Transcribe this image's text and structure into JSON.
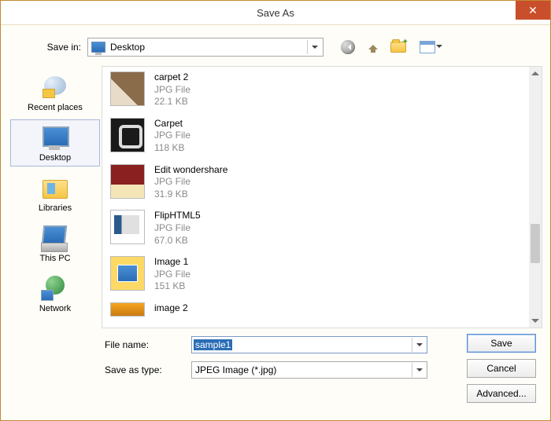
{
  "window": {
    "title": "Save As"
  },
  "top": {
    "save_in_label": "Save in:",
    "location": "Desktop"
  },
  "sidebar": {
    "places": [
      {
        "label": "Recent places"
      },
      {
        "label": "Desktop"
      },
      {
        "label": "Libraries"
      },
      {
        "label": "This PC"
      },
      {
        "label": "Network"
      }
    ],
    "selected_index": 1
  },
  "files": [
    {
      "name": "carpet 2",
      "type": "JPG File",
      "size": "22.1 KB"
    },
    {
      "name": "Carpet",
      "type": "JPG File",
      "size": "118 KB"
    },
    {
      "name": "Edit wondershare",
      "type": "JPG File",
      "size": "31.9 KB"
    },
    {
      "name": "FlipHTML5",
      "type": "JPG File",
      "size": "67.0 KB"
    },
    {
      "name": "Image 1",
      "type": "JPG File",
      "size": "151 KB"
    },
    {
      "name": "image 2",
      "type": "",
      "size": ""
    }
  ],
  "form": {
    "filename_label": "File name:",
    "filename_value": "sample1",
    "savetype_label": "Save as type:",
    "savetype_value": "JPEG Image (*.jpg)"
  },
  "buttons": {
    "save": "Save",
    "cancel": "Cancel",
    "advanced": "Advanced..."
  }
}
